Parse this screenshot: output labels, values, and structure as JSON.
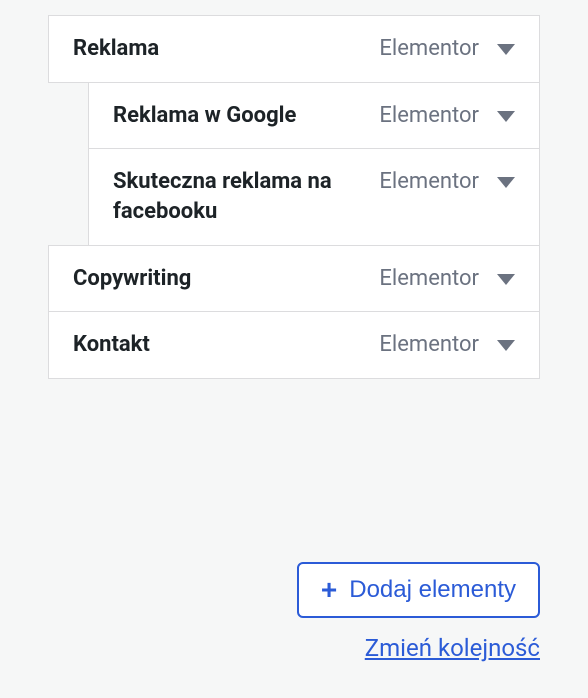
{
  "menu": {
    "type_label": "Elementor",
    "items": [
      {
        "label": "Reklama",
        "level": 0,
        "slug": "reklama"
      },
      {
        "label": "Reklama w Google",
        "level": 1,
        "slug": "reklama-w-google"
      },
      {
        "label": "Skuteczna reklama na facebooku",
        "level": 1,
        "slug": "skuteczna-reklama-na-facebooku"
      },
      {
        "label": "Copywriting",
        "level": 0,
        "slug": "copywriting"
      },
      {
        "label": "Kontakt",
        "level": 0,
        "slug": "kontakt"
      }
    ]
  },
  "actions": {
    "add_label": "Dodaj elementy",
    "reorder_label": "Zmień kolejność"
  }
}
